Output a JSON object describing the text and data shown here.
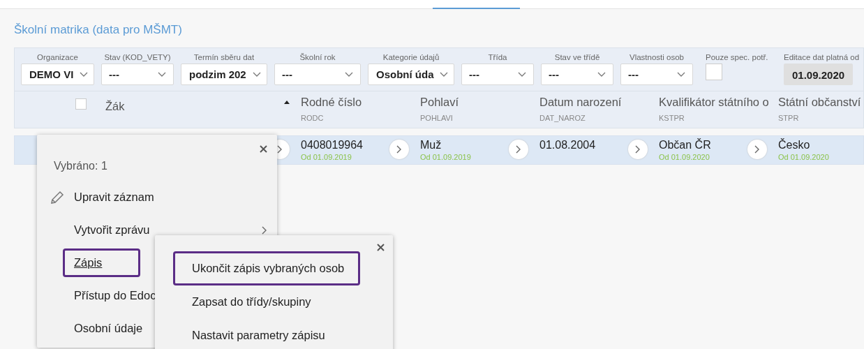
{
  "title": "Školní matrika (data pro MŠMT)",
  "filters": [
    {
      "kind": "select",
      "label": "Organizace",
      "value": "DEMO VI"
    },
    {
      "kind": "select",
      "label": "Stav (KOD_VETY)",
      "value": "---"
    },
    {
      "kind": "select",
      "label": "Termín sběru dat",
      "value": "podzim 202"
    },
    {
      "kind": "select",
      "label": "Školní rok",
      "value": "---"
    },
    {
      "kind": "select",
      "label": "Kategorie údajů",
      "value": "Osobní úda"
    },
    {
      "kind": "select",
      "label": "Třída",
      "value": "---"
    },
    {
      "kind": "select",
      "label": "Stav ve třídě",
      "value": "---"
    },
    {
      "kind": "select",
      "label": "Vlastnosti osob",
      "value": "---"
    },
    {
      "kind": "checkbox",
      "label": "Pouze spec. potř.",
      "checked": false
    },
    {
      "kind": "date",
      "label": "Editace dat platná od",
      "value": "01.09.2020"
    }
  ],
  "table": {
    "select_all": {
      "checked": false
    },
    "columns": [
      {
        "title": "Žák"
      },
      {
        "title": "Rodné číslo",
        "code": "RODC",
        "sorted": true
      },
      {
        "title": "Pohlaví",
        "code": "POHLAVI"
      },
      {
        "title": "Datum narození",
        "code": "DAT_NAROZ"
      },
      {
        "title": "Kvalifikátor státního o",
        "code": "KSTPR"
      },
      {
        "title": "Státní občanství",
        "code": "STPR"
      }
    ],
    "rows": [
      {
        "selected": true,
        "cells": [
          {},
          {
            "value": "0408019964",
            "since": "Od 01.09.2019"
          },
          {
            "value": "Muž",
            "since": "Od 01.09.2019"
          },
          {
            "value": "01.08.2004"
          },
          {
            "value": "Občan ČR",
            "since": "Od 01.09.2020"
          },
          {
            "value": "Česko",
            "since": "Od 01.09.2020"
          }
        ]
      }
    ]
  },
  "context_menu": {
    "caption": "Vybráno: 1",
    "items": [
      {
        "label": "Upravit záznam",
        "highlighted": false,
        "underlined": false
      },
      {
        "label": "Vytvořit zprávu",
        "submenu": true,
        "highlighted": false,
        "underlined": false
      },
      {
        "label": "Zápis",
        "highlighted": true,
        "underlined": true
      },
      {
        "label": "Přístup do Edoc",
        "highlighted": false,
        "underlined": false
      },
      {
        "label": "Osobní údaje",
        "highlighted": false,
        "underlined": false
      }
    ]
  },
  "submenu": {
    "items": [
      {
        "label": "Ukončit zápis vybraných osob",
        "highlighted": true
      },
      {
        "label": "Zapsat do třídy/skupiny",
        "highlighted": false
      },
      {
        "label": "Nastavit parametry zápisu",
        "highlighted": false
      }
    ]
  }
}
